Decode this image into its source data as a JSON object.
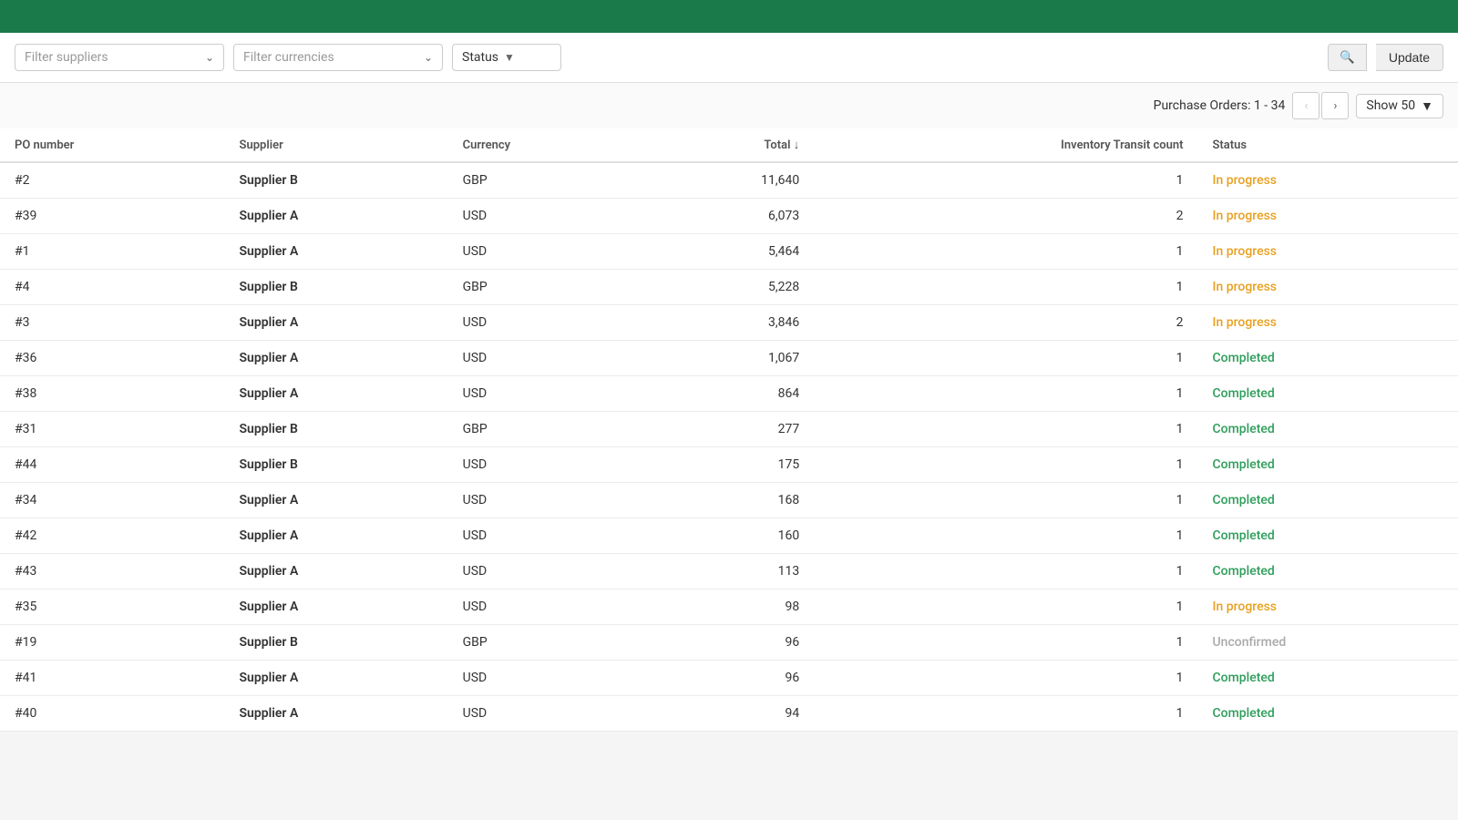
{
  "topBar": {},
  "filterBar": {
    "suppliersPlaceholder": "Filter suppliers",
    "currenciesPlaceholder": "Filter currencies",
    "statusLabel": "Status",
    "searchIcon": "🔍",
    "updateLabel": "Update"
  },
  "pagination": {
    "label": "Purchase Orders:",
    "range": "1 - 34",
    "showLabel": "Show 50"
  },
  "table": {
    "columns": [
      {
        "key": "po_number",
        "label": "PO number"
      },
      {
        "key": "supplier",
        "label": "Supplier"
      },
      {
        "key": "currency",
        "label": "Currency"
      },
      {
        "key": "total",
        "label": "Total ↓"
      },
      {
        "key": "transit",
        "label": "Inventory Transit count"
      },
      {
        "key": "status",
        "label": "Status"
      }
    ],
    "rows": [
      {
        "po": "#2",
        "supplier": "Supplier B",
        "currency": "GBP",
        "total": "11,640",
        "transit": 1,
        "status": "In progress",
        "statusClass": "in-progress"
      },
      {
        "po": "#39",
        "supplier": "Supplier A",
        "currency": "USD",
        "total": "6,073",
        "transit": 2,
        "status": "In progress",
        "statusClass": "in-progress"
      },
      {
        "po": "#1",
        "supplier": "Supplier A",
        "currency": "USD",
        "total": "5,464",
        "transit": 1,
        "status": "In progress",
        "statusClass": "in-progress"
      },
      {
        "po": "#4",
        "supplier": "Supplier B",
        "currency": "GBP",
        "total": "5,228",
        "transit": 1,
        "status": "In progress",
        "statusClass": "in-progress"
      },
      {
        "po": "#3",
        "supplier": "Supplier A",
        "currency": "USD",
        "total": "3,846",
        "transit": 2,
        "status": "In progress",
        "statusClass": "in-progress"
      },
      {
        "po": "#36",
        "supplier": "Supplier A",
        "currency": "USD",
        "total": "1,067",
        "transit": 1,
        "status": "Completed",
        "statusClass": "completed"
      },
      {
        "po": "#38",
        "supplier": "Supplier A",
        "currency": "USD",
        "total": "864",
        "transit": 1,
        "status": "Completed",
        "statusClass": "completed"
      },
      {
        "po": "#31",
        "supplier": "Supplier B",
        "currency": "GBP",
        "total": "277",
        "transit": 1,
        "status": "Completed",
        "statusClass": "completed"
      },
      {
        "po": "#44",
        "supplier": "Supplier B",
        "currency": "USD",
        "total": "175",
        "transit": 1,
        "status": "Completed",
        "statusClass": "completed"
      },
      {
        "po": "#34",
        "supplier": "Supplier A",
        "currency": "USD",
        "total": "168",
        "transit": 1,
        "status": "Completed",
        "statusClass": "completed"
      },
      {
        "po": "#42",
        "supplier": "Supplier A",
        "currency": "USD",
        "total": "160",
        "transit": 1,
        "status": "Completed",
        "statusClass": "completed"
      },
      {
        "po": "#43",
        "supplier": "Supplier A",
        "currency": "USD",
        "total": "113",
        "transit": 1,
        "status": "Completed",
        "statusClass": "completed"
      },
      {
        "po": "#35",
        "supplier": "Supplier A",
        "currency": "USD",
        "total": "98",
        "transit": 1,
        "status": "In progress",
        "statusClass": "in-progress"
      },
      {
        "po": "#19",
        "supplier": "Supplier B",
        "currency": "GBP",
        "total": "96",
        "transit": 1,
        "status": "Unconfirmed",
        "statusClass": "unconfirmed"
      },
      {
        "po": "#41",
        "supplier": "Supplier A",
        "currency": "USD",
        "total": "96",
        "transit": 1,
        "status": "Completed",
        "statusClass": "completed"
      },
      {
        "po": "#40",
        "supplier": "Supplier A",
        "currency": "USD",
        "total": "94",
        "transit": 1,
        "status": "Completed",
        "statusClass": "completed"
      }
    ]
  }
}
